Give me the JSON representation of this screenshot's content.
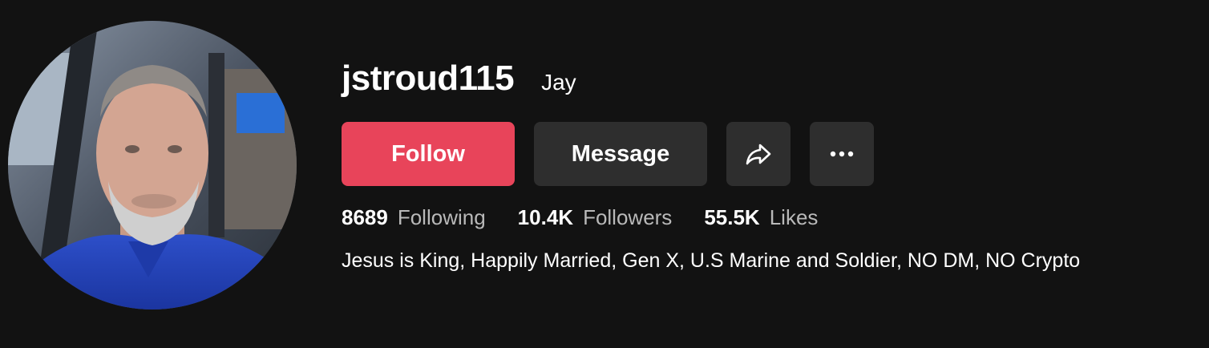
{
  "profile": {
    "username": "jstroud115",
    "nickname": "Jay",
    "avatar_alt": "profile-photo"
  },
  "actions": {
    "follow_label": "Follow",
    "message_label": "Message",
    "share_icon": "share-arrow-icon",
    "more_icon": "more-dots-icon"
  },
  "stats": {
    "following_count": "8689",
    "following_label": "Following",
    "followers_count": "10.4K",
    "followers_label": "Followers",
    "likes_count": "55.5K",
    "likes_label": "Likes"
  },
  "bio": "Jesus is King, Happily Married, Gen X, U.S Marine and Soldier, NO DM, NO Crypto",
  "colors": {
    "background": "#121212",
    "follow_button": "#e8445a",
    "secondary_button": "#2e2e2e",
    "muted_text": "#b9b9b9"
  }
}
